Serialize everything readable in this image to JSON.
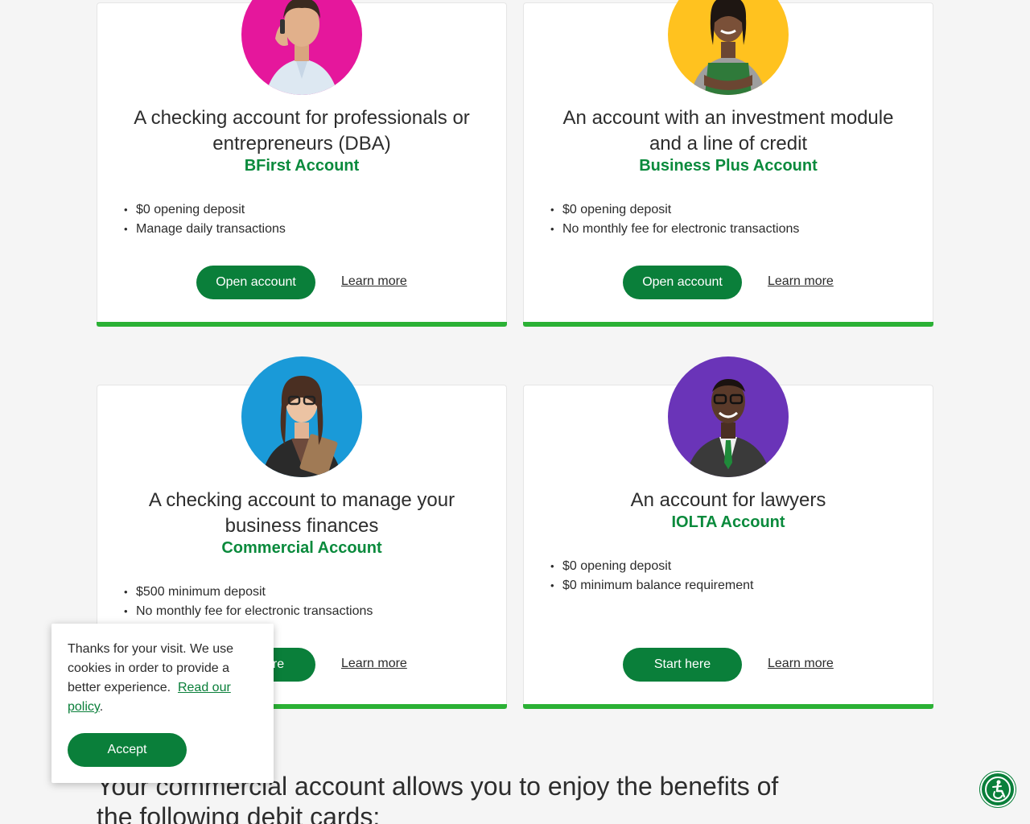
{
  "cards": [
    {
      "title": "A checking account for professionals or entrepreneurs (DBA)",
      "subtitle": "BFirst Account",
      "bullets": [
        "$0 opening deposit",
        "Manage daily transactions"
      ],
      "primary_label": "Open account",
      "link_label": "Learn more"
    },
    {
      "title": "An account with an investment module and a line of credit",
      "subtitle": "Business Plus Account",
      "bullets": [
        "$0 opening deposit",
        "No monthly fee for electronic transactions"
      ],
      "primary_label": "Open account",
      "link_label": "Learn more"
    },
    {
      "title": "A checking account to manage your business finances",
      "subtitle": "Commercial Account",
      "bullets": [
        "$500 minimum deposit",
        "No monthly fee for electronic transactions"
      ],
      "primary_label": "Start here",
      "link_label": "Learn more"
    },
    {
      "title": "An account for lawyers",
      "subtitle": "IOLTA Account",
      "bullets": [
        "$0 opening deposit",
        "$0 minimum balance requirement"
      ],
      "primary_label": "Start here",
      "link_label": "Learn more"
    }
  ],
  "bottom_heading": "Your commercial account allows you to enjoy the benefits of the following debit cards:",
  "cookie": {
    "text": "Thanks for your visit. We use cookies in order to provide a better experience.",
    "link_label": "Read our policy",
    "accept_label": "Accept"
  },
  "icons": {
    "avatar_backgrounds": [
      "#e5179c",
      "#ffc21f",
      "#1a9ad8",
      "#6a34b8"
    ],
    "accessibility": "accessibility-icon"
  },
  "colors": {
    "brand_green": "#0a7f3a",
    "accent_bar": "#2bb135",
    "subtitle_green": "#0a8a3c"
  }
}
